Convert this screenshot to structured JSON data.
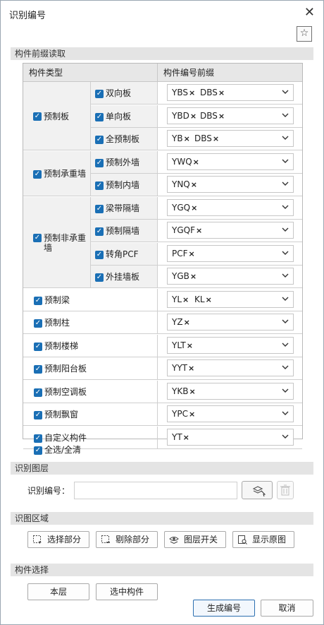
{
  "window": {
    "title": "识别编号"
  },
  "sections": {
    "prefix": "构件前缀读取",
    "layer": "识别图层",
    "region": "识图区域",
    "component_select": "构件选择"
  },
  "table": {
    "headers": {
      "type": "构件类型",
      "prefix": "构件编号前缀"
    },
    "categories": [
      {
        "label": "预制板"
      },
      {
        "label": "预制承重墙"
      },
      {
        "label": "预制非承重墙"
      }
    ],
    "rows": [
      {
        "label": "双向板",
        "tags": [
          "YBS",
          "DBS"
        ]
      },
      {
        "label": "单向板",
        "tags": [
          "YBD",
          "DBS"
        ]
      },
      {
        "label": "全预制板",
        "tags": [
          "YB",
          "DBS"
        ]
      },
      {
        "label": "预制外墙",
        "tags": [
          "YWQ"
        ]
      },
      {
        "label": "预制内墙",
        "tags": [
          "YNQ"
        ]
      },
      {
        "label": "梁带隔墙",
        "tags": [
          "YGQ"
        ]
      },
      {
        "label": "预制隔墙",
        "tags": [
          "YGQF"
        ]
      },
      {
        "label": "转角PCF",
        "tags": [
          "PCF"
        ]
      },
      {
        "label": "外挂墙板",
        "tags": [
          "YGB"
        ]
      },
      {
        "label": "预制梁",
        "tags": [
          "YL",
          "KL"
        ]
      },
      {
        "label": "预制柱",
        "tags": [
          "YZ"
        ]
      },
      {
        "label": "预制楼梯",
        "tags": [
          "YLT"
        ]
      },
      {
        "label": "预制阳台板",
        "tags": [
          "YYT"
        ]
      },
      {
        "label": "预制空调板",
        "tags": [
          "YKB"
        ]
      },
      {
        "label": "预制飘窗",
        "tags": [
          "YPC"
        ]
      },
      {
        "label": "自定义构件",
        "tags": [
          "YT"
        ]
      }
    ]
  },
  "select_all": "全选/全清",
  "layer": {
    "label": "识别编号：",
    "value": ""
  },
  "region_buttons": {
    "select_part": "选择部分",
    "remove_part": "剔除部分",
    "layer_toggle": "图层开关",
    "show_original": "显示原图"
  },
  "component_buttons": {
    "this_layer": "本层",
    "selected": "选中构件"
  },
  "footer": {
    "generate": "生成编号",
    "cancel": "取消"
  },
  "colors": {
    "checkbox": "#1a6fb5",
    "primary_border": "#2c6fb0"
  }
}
